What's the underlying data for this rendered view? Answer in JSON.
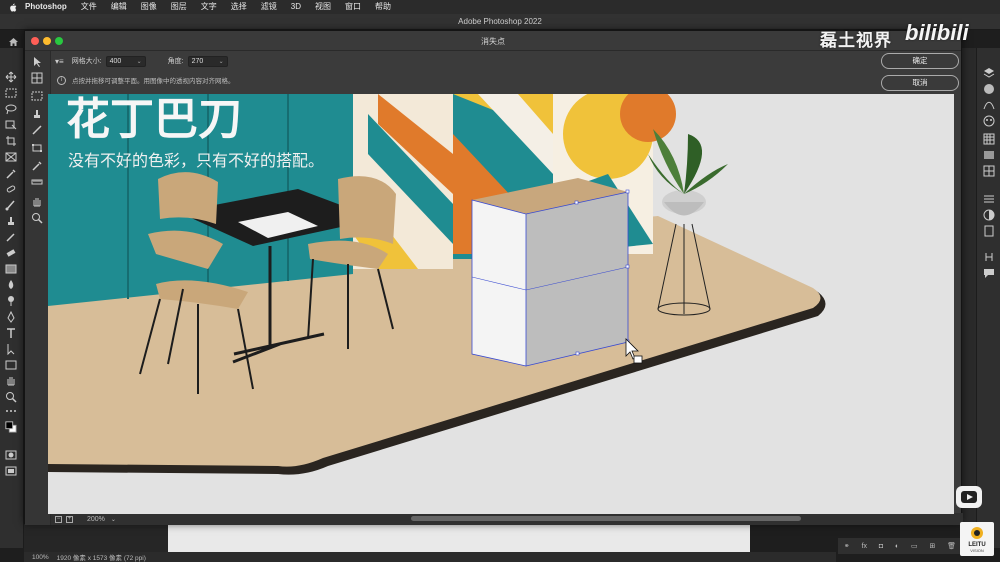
{
  "menubar": {
    "items": [
      "Photoshop",
      "文件",
      "编辑",
      "图像",
      "图层",
      "文字",
      "选择",
      "滤镜",
      "3D",
      "视图",
      "窗口",
      "帮助"
    ]
  },
  "app": {
    "title": "Adobe Photoshop 2022"
  },
  "dialog": {
    "title": "消失点",
    "options": {
      "grid_size_label": "网格大小:",
      "grid_size_value": "400",
      "angle_label": "角度:",
      "angle_value": "270"
    },
    "hint": "点按并拖移可调整平面。用图像中的透视内容对齐网格。",
    "ok_label": "确定",
    "cancel_label": "取消",
    "zoom": "200%"
  },
  "canvas": {
    "banner_text": "没有不好的色彩，只有不好的搭配。",
    "headline_partial": "花丁巴刀"
  },
  "statusbar": {
    "zoom": "100%",
    "doc_info": "1920 像素 x 1573 像素 (72 ppi)"
  },
  "watermark": {
    "channel": "磊土视界",
    "site": "bilibili",
    "logo_text": "LEITU",
    "logo_sub": "VISION"
  },
  "layers_footer": {
    "fx_label": "fx"
  },
  "colors": {
    "teal": "#1f8c91",
    "floor": "#d9bf9c",
    "floor_edge": "#2a2520",
    "orange": "#e07a2b",
    "yellow": "#f0c23a"
  }
}
